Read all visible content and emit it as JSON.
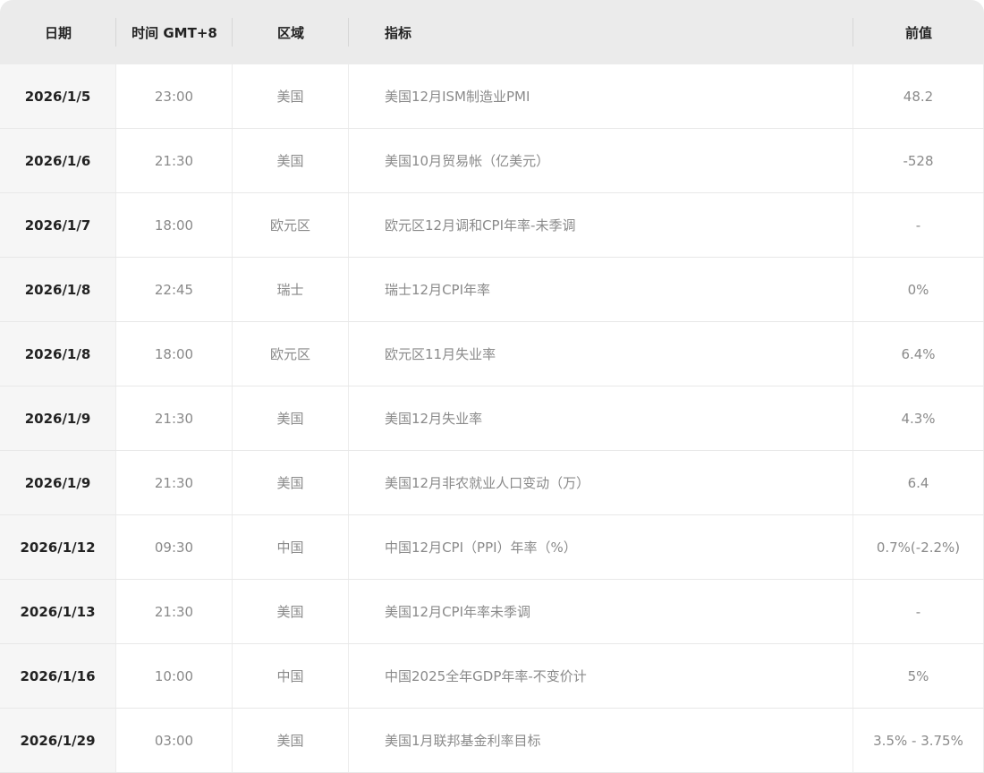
{
  "header": {
    "date": "日期",
    "time": "时间 GMT+8",
    "region": "区域",
    "indicator": "指标",
    "previous": "前值"
  },
  "rows": [
    {
      "date": "2026/1/5",
      "time": "23:00",
      "region": "美国",
      "indicator": "美国12月ISM制造业PMI",
      "previous": "48.2"
    },
    {
      "date": "2026/1/6",
      "time": "21:30",
      "region": "美国",
      "indicator": "美国10月贸易帐（亿美元）",
      "previous": "-528"
    },
    {
      "date": "2026/1/7",
      "time": "18:00",
      "region": "欧元区",
      "indicator": "欧元区12月调和CPI年率-未季调",
      "previous": "-"
    },
    {
      "date": "2026/1/8",
      "time": "22:45",
      "region": "瑞士",
      "indicator": "瑞士12月CPI年率",
      "previous": "0%"
    },
    {
      "date": "2026/1/8",
      "time": "18:00",
      "region": "欧元区",
      "indicator": "欧元区11月失业率",
      "previous": "6.4%"
    },
    {
      "date": "2026/1/9",
      "time": "21:30",
      "region": "美国",
      "indicator": "美国12月失业率",
      "previous": "4.3%"
    },
    {
      "date": "2026/1/9",
      "time": "21:30",
      "region": "美国",
      "indicator": "美国12月非农就业人口变动（万）",
      "previous": "6.4"
    },
    {
      "date": "2026/1/12",
      "time": "09:30",
      "region": "中国",
      "indicator": "中国12月CPI（PPI）年率（%）",
      "previous": "0.7%(-2.2%)"
    },
    {
      "date": "2026/1/13",
      "time": "21:30",
      "region": "美国",
      "indicator": "美国12月CPI年率未季调",
      "previous": "-"
    },
    {
      "date": "2026/1/16",
      "time": "10:00",
      "region": "中国",
      "indicator": "中国2025全年GDP年率-不变价计",
      "previous": "5%"
    },
    {
      "date": "2026/1/29",
      "time": "03:00",
      "region": "美国",
      "indicator": "美国1月联邦基金利率目标",
      "previous": "3.5% - 3.75%"
    }
  ]
}
